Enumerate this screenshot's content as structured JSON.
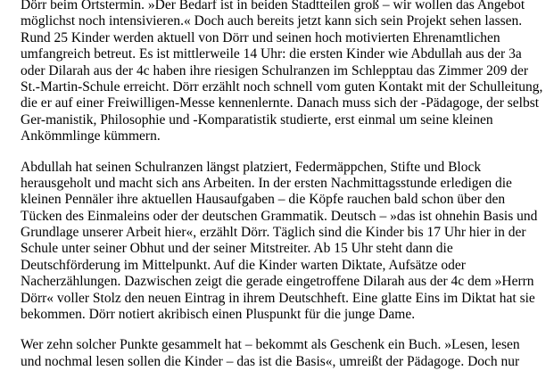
{
  "paragraphs": [
    {
      "lines": [
        "Dörr beim Ortstermin. »Der Bedarf ist in beiden Stadtteilen groß – wir wollen das Angebot",
        "möglichst noch intensivieren.« Doch auch bereits jetzt kann sich sein Projekt sehen lassen.",
        "Rund 25 Kinder werden aktuell von Dörr und seinen hoch motivierten Ehrenamtlichen",
        "umfangreich betreut. Es ist mittlerweile 14 Uhr: die ersten Kinder wie Abdullah aus der 3a",
        "oder Dilarah aus der 4c haben ihre riesigen Schulranzen im Schlepptau das Zimmer 209 der",
        "St.-Martin-Schule erreicht. Dörr erzählt noch schnell vom guten Kontakt mit der Schulleitung,",
        "die er auf einer Freiwilligen-Messe kennenlernte. Danach muss sich der -Pädagoge, der selbst",
        "Ger-manistik, Philosophie und -Komparatistik studierte, erst einmal um seine kleinen",
        "Ankömmlinge kümmern."
      ]
    },
    {
      "lines": [
        "Abdullah hat seinen Schulranzen längst platziert, Federmäppchen, Stifte und Block",
        "herausgeholt und macht sich ans Arbeiten. In der ersten Nachmittagsstunde erledigen die",
        "kleinen Pennäler ihre aktuellen Hausaufgaben – die Köpfe rauchen bald schon über den",
        "Tücken des Einmaleins oder der deutschen Grammatik. Deutsch – »das ist ohnehin Basis und",
        "Grundlage unserer Arbeit hier«, erzählt Dörr. Täglich sind die Kinder bis 17 Uhr hier in der",
        "Schule unter seiner Obhut und der seiner Mitstreiter. Ab 15 Uhr steht dann die",
        "Deutschförderung im Mittelpunkt. Auf die Kinder warten Diktate, Aufsätze oder",
        "Nacherzählungen. Dazwischen zeigt die gerade eingetroffene Dilarah aus der 4c dem »Herrn",
        "Dörr« voller Stolz den neuen Eintrag in ihrem Deutschheft. Eine glatte Eins im Diktat hat sie",
        "bekommen. Dörr notiert akribisch einen Pluspunkt für die junge Dame."
      ]
    },
    {
      "lines": [
        "Wer zehn solcher Punkte gesammelt hat – bekommt als Geschenk ein Buch. »Lesen, lesen",
        "und nochmal lesen sollen die Kinder – das ist die Basis«, umreißt der Pädagoge. Doch nur"
      ]
    }
  ]
}
